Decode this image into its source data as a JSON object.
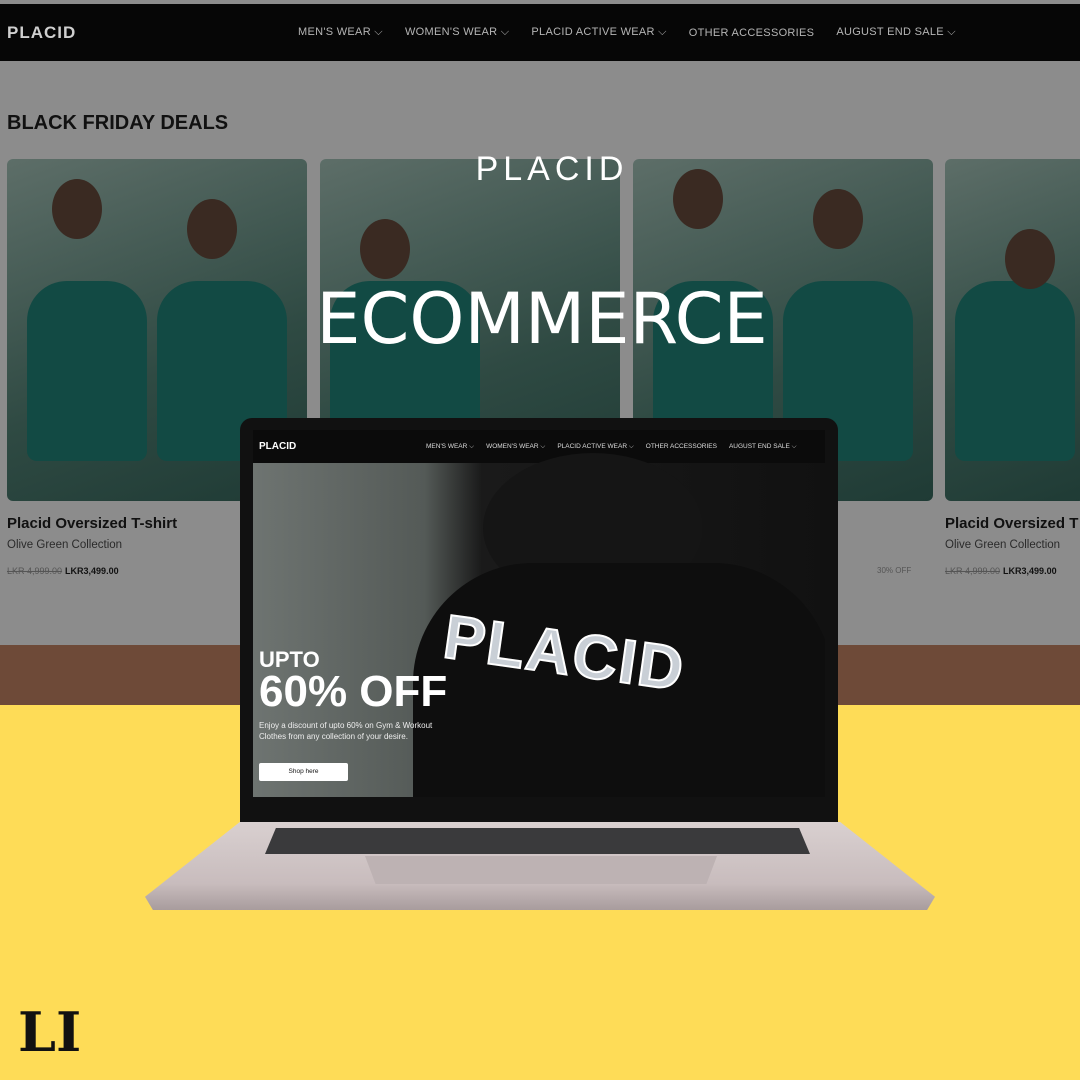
{
  "site": {
    "logo": "PLACID",
    "menu": [
      "MEN'S WEAR ⌵",
      "WOMEN'S WEAR ⌵",
      "PLACID ACTIVE WEAR ⌵",
      "OTHER ACCESSORIES",
      "AUGUST END SALE ⌵"
    ]
  },
  "section_title": "BLACK FRIDAY DEALS",
  "products": [
    {
      "title": "Placid Oversized T-shirt",
      "subtitle": "Olive Green Collection",
      "old_price": "LKR 4,999.00",
      "price": "LKR3,499.00"
    },
    {
      "title": "Placid Oversized T",
      "subtitle": "Olive Green Collection",
      "old_price": "LKR 4,999.00",
      "price": "LKR3,499.00",
      "badge": "30% OFF"
    }
  ],
  "overlay": {
    "brand": "PLACID",
    "headline": "ECOMMERCE"
  },
  "laptop": {
    "logo": "PLACID",
    "menu": [
      "MEN'S WEAR ⌵",
      "WOMEN'S WEAR ⌵",
      "PLACID ACTIVE WEAR ⌵",
      "OTHER ACCESSORIES",
      "AUGUST END SALE ⌵"
    ],
    "hero": {
      "shirt_print": "PLACID",
      "upto": "UPTO",
      "offer": "60% OFF",
      "description": "Enjoy a discount of upto 60% on Gym & Workout Clothes from any collection of your desire.",
      "button": "Shop here"
    }
  },
  "corner_logo": "LI",
  "colors": {
    "yellow": "#fedc57",
    "nav": "#060606",
    "shirt_green": "#124a44"
  }
}
